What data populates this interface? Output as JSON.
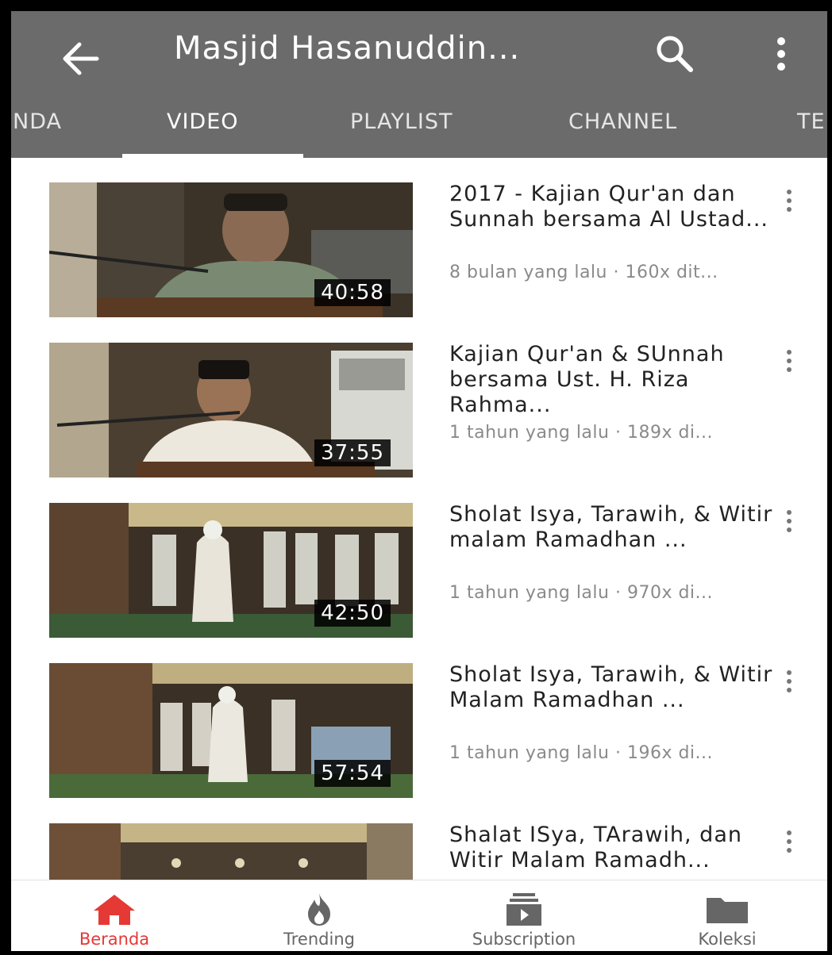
{
  "header": {
    "title": "Masjid Hasanuddin...",
    "background_color": "#6b6b6b"
  },
  "tabs": [
    {
      "label": "NDA",
      "active": false
    },
    {
      "label": "VIDEO",
      "active": true
    },
    {
      "label": "PLAYLIST",
      "active": false
    },
    {
      "label": "CHANNEL",
      "active": false
    },
    {
      "label": "TE",
      "active": false
    }
  ],
  "videos": [
    {
      "title": "2017 - Kajian Qur'an dan Sunnah bersama  Al Ustad...",
      "meta": "8 bulan yang lalu · 160x dit...",
      "duration": "40:58"
    },
    {
      "title": "Kajian Qur'an & SUnnah bersama Ust. H. Riza Rahma...",
      "meta": "1 tahun yang lalu · 189x di...",
      "duration": "37:55"
    },
    {
      "title": "Sholat Isya, Tarawih, & Witir malam Ramadhan ...",
      "meta": "1 tahun yang lalu · 970x di...",
      "duration": "42:50"
    },
    {
      "title": "Sholat Isya, Tarawih, & Witir Malam Ramadhan ...",
      "meta": "1 tahun yang lalu · 196x di...",
      "duration": "57:54"
    },
    {
      "title": "Shalat ISya, TArawih, dan Witir Malam Ramadh...",
      "meta": "",
      "duration": ""
    }
  ],
  "bottom_nav": [
    {
      "label": "Beranda",
      "icon": "home-icon",
      "active": true
    },
    {
      "label": "Trending",
      "icon": "flame-icon",
      "active": false
    },
    {
      "label": "Subscription",
      "icon": "subscriptions-icon",
      "active": false
    },
    {
      "label": "Koleksi",
      "icon": "folder-icon",
      "active": false
    }
  ],
  "colors": {
    "accent": "#e53935",
    "inactive_nav": "#666666",
    "meta_text": "#8a8a8a"
  }
}
